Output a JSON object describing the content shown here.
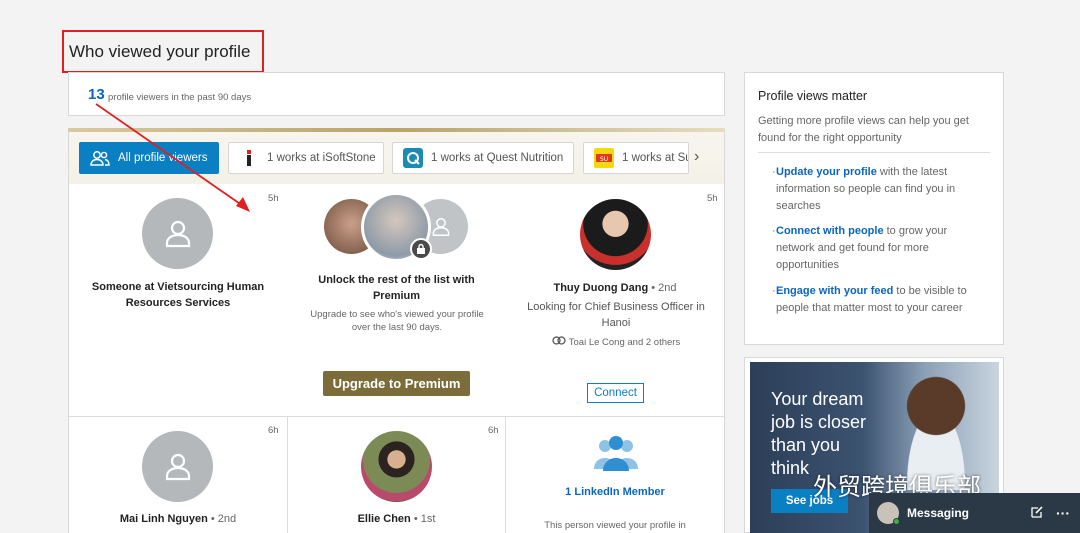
{
  "page": {
    "title": "Who viewed your profile"
  },
  "summary": {
    "count": "13",
    "label": "profile viewers in the past 90 days"
  },
  "tabs": [
    {
      "label": "All profile viewers",
      "icon": "people-icon"
    },
    {
      "label": "1 works at iSoftStone",
      "icon": "isoftstone-logo"
    },
    {
      "label": "1 works at Quest Nutrition",
      "icon": "quest-logo"
    },
    {
      "label": "1 works at Su",
      "icon": "company-logo"
    }
  ],
  "viewers": [
    {
      "name": "Someone at Vietsourcing Human Resources Services",
      "time": "5h"
    },
    {
      "title": "Unlock the rest of the list with Premium",
      "desc": "Upgrade to see who's viewed your profile over the last 90 days.",
      "button": "Upgrade to Premium"
    },
    {
      "name": "Thuy Duong Dang",
      "degree": "• 2nd",
      "headline": "Looking for Chief Business Officer in Hanoi",
      "shared": "Toai Le Cong and 2 others",
      "time": "5h",
      "button": "Connect"
    },
    {
      "name": "Mai Linh Nguyen",
      "degree": "• 2nd",
      "time": "6h"
    },
    {
      "name": "Ellie Chen",
      "degree": "• 1st",
      "time": "6h"
    },
    {
      "name": "1 LinkedIn Member",
      "desc": "This person viewed your profile in"
    }
  ],
  "sidebar": {
    "title": "Profile views matter",
    "intro": "Getting more profile views can help you get found for the right opportunity",
    "items": [
      {
        "link": "Update your profile",
        "rest": " with the latest information so people can find you in searches"
      },
      {
        "link": "Connect with people",
        "rest": " to grow your network and get found for more opportunities"
      },
      {
        "link": "Engage with your feed",
        "rest": " to be visible to people that matter most to your career"
      }
    ]
  },
  "ad": {
    "text": "Your dream job is closer than you think",
    "button": "See jobs"
  },
  "messaging": {
    "label": "Messaging"
  },
  "watermark": "外贸跨境俱乐部",
  "colors": {
    "link": "#0a66c2",
    "tab_active": "#0a7fc2",
    "premium": "#7b6c3a",
    "annotation": "#e02020"
  }
}
